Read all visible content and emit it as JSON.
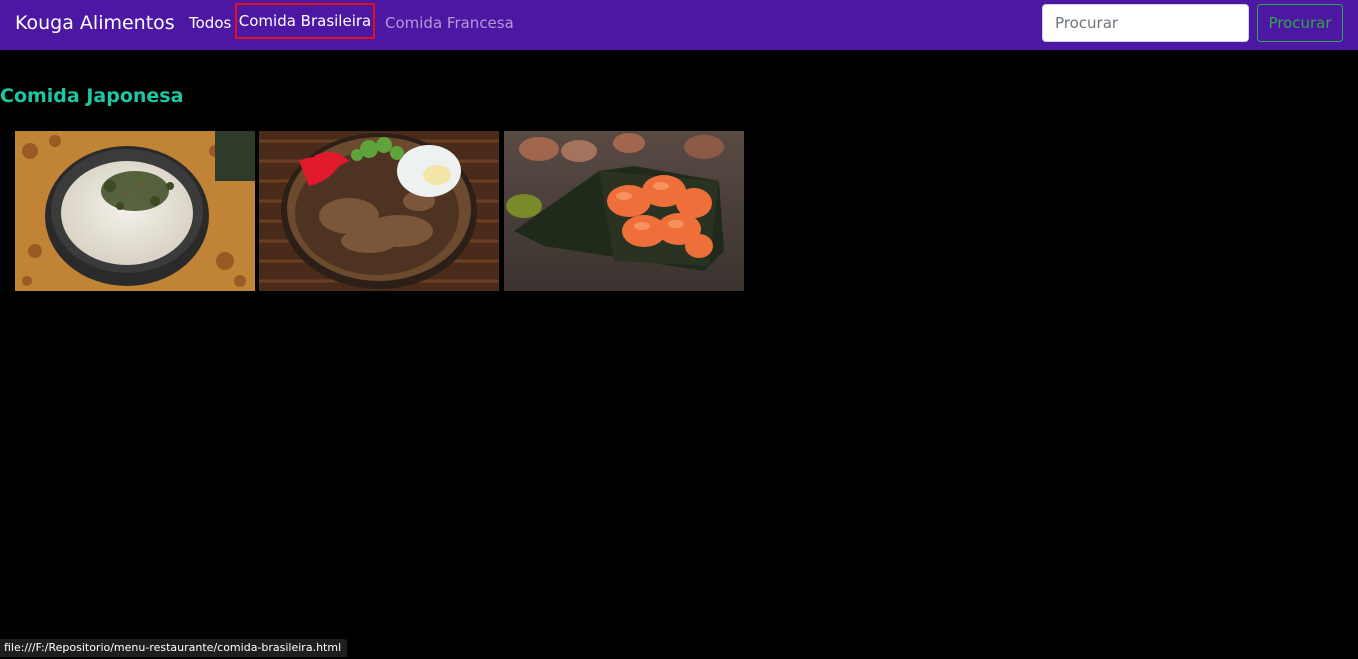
{
  "navbar": {
    "brand": "Kouga Alimentos",
    "links": [
      {
        "label": "Todos"
      },
      {
        "label": "Comida Brasileira"
      },
      {
        "label": "Comida Francesa"
      }
    ],
    "search": {
      "placeholder": "Procurar",
      "value": "",
      "button_label": "Procurar"
    }
  },
  "main": {
    "section_title": "Comida Japonesa",
    "images": [
      {
        "alt": "rice bowl with furikake"
      },
      {
        "alt": "beef gyudon bowl"
      },
      {
        "alt": "salmon temaki"
      }
    ]
  },
  "status_bar": {
    "url": "file:///F:/Repositorio/menu-restaurante/comida-brasileira.html"
  },
  "colors": {
    "navbar_bg": "#4c17a3",
    "page_bg": "#000000",
    "section_title": "#20c6a2",
    "highlight_border": "#e0101c",
    "search_button": "#2fa84a"
  }
}
